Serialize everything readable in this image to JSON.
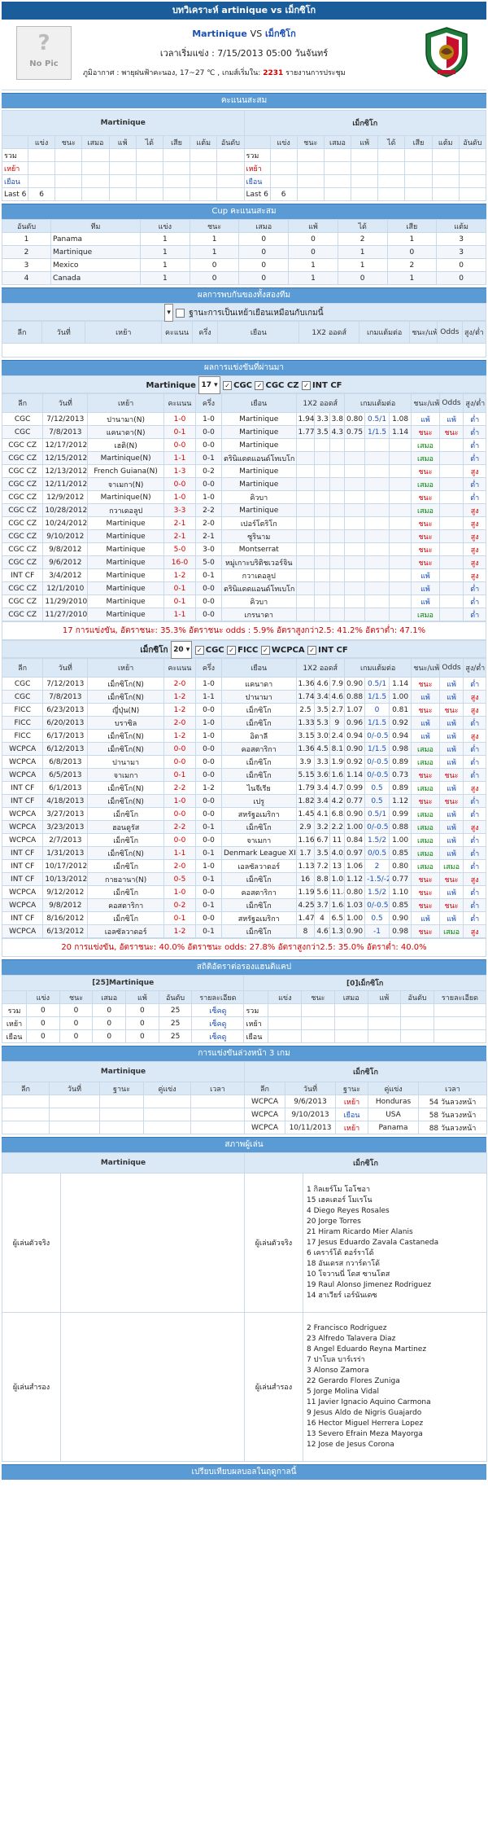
{
  "page_title": "บทวิเคราะห์ artinique vs เม็กซิโก",
  "match": {
    "nopic": "No Pic",
    "home": "Martinique",
    "vs": "VS",
    "away": "เม็กซิโก",
    "kickoff": "เวลาเริ่มแข่ง : 7/15/2013 05:00 วันจันทร์",
    "weather_label": "ภูมิอากาศ :",
    "weather": "พายุฝนฟ้าคะนอง, 17~27 ℃ , เกมส์เริ่มใน:",
    "countdown": "2231",
    "countdown_suffix": "รายงานการประชุม"
  },
  "standings": {
    "section": "คะแนนสะสม",
    "home_name": "Martinique",
    "away_name": "เม็กซิโก",
    "cols": [
      "แข่ง",
      "ชนะ",
      "เสมอ",
      "แพ้",
      "ได้",
      "เสีย",
      "แต้ม",
      "อันดับ"
    ],
    "rows": [
      "รวม",
      "เหย้า",
      "เยือน",
      "Last 6"
    ],
    "home_last6": "6",
    "away_last6": "6"
  },
  "cup": {
    "section": "Cup คะแนนสะสม",
    "headers": [
      "อันดับ",
      "ทีม",
      "แข่ง",
      "ชนะ",
      "เสมอ",
      "แพ้",
      "ได้",
      "เสีย",
      "แต้ม"
    ],
    "rows": [
      [
        "1",
        "Panama",
        "1",
        "1",
        "0",
        "0",
        "2",
        "1",
        "3"
      ],
      [
        "2",
        "Martinique",
        "1",
        "1",
        "0",
        "0",
        "1",
        "0",
        "3"
      ],
      [
        "3",
        "Mexico",
        "1",
        "0",
        "0",
        "1",
        "1",
        "2",
        "0"
      ],
      [
        "4",
        "Canada",
        "1",
        "0",
        "0",
        "1",
        "0",
        "1",
        "0"
      ]
    ]
  },
  "h2h": {
    "section": "ผลการพบกันของทั้งสองทีม",
    "same_venue": "ฐานะการเป็นเหย้าเยือนเหมือนกับเกมนี้",
    "headers": [
      "ลีก",
      "วันที่",
      "เหย้า",
      "คะแนน",
      "ครึ่ง",
      "เยือน",
      "1X2 ออดส์",
      "เกมแต้มต่อ",
      "ชนะ/แพ้",
      "Odds",
      "สูง/ต่ำ"
    ]
  },
  "recent": {
    "section": "ผลการแข่งขันที่ผ่านมา",
    "home_team": "Martinique",
    "home_select": "17",
    "home_filters": [
      "CGC",
      "CGC CZ",
      "INT CF"
    ],
    "headers": [
      "ลีก",
      "วันที่",
      "เหย้า",
      "คะแนน",
      "ครึ่ง",
      "เยือน",
      "1X2 ออดส์",
      "เกมแต้มต่อ",
      "ชนะ/แพ้",
      "Odds",
      "สูง/ต่ำ"
    ],
    "home_rows": [
      [
        "CGC",
        "7/12/2013",
        "ปานามา(N)",
        "1-0",
        "1-0",
        "Martinique",
        "1.94",
        "3.3",
        "3.8",
        "0.80",
        "0.5/1",
        "1.08",
        "แพ้",
        "แพ้",
        "ต่ำ"
      ],
      [
        "CGC",
        "7/8/2013",
        "แคนาดา(N)",
        "0-1",
        "0-0",
        "Martinique",
        "1.77",
        "3.5",
        "4.3",
        "0.75",
        "1/1.5",
        "1.14",
        "ชนะ",
        "ชนะ",
        "ต่ำ"
      ],
      [
        "CGC CZ",
        "12/17/2012",
        "เฮติ(N)",
        "0-0",
        "0-0",
        "Martinique",
        "",
        "",
        "",
        "",
        "",
        "",
        "เสมอ",
        "",
        "ต่ำ"
      ],
      [
        "CGC CZ",
        "12/15/2012",
        "Martinique(N)",
        "1-1",
        "0-1",
        "ตรินิแดดแอนด์โทเบโก",
        "",
        "",
        "",
        "",
        "",
        "",
        "เสมอ",
        "",
        "ต่ำ"
      ],
      [
        "CGC CZ",
        "12/13/2012",
        "French Guiana(N)",
        "1-3",
        "0-2",
        "Martinique",
        "",
        "",
        "",
        "",
        "",
        "",
        "ชนะ",
        "",
        "สูง"
      ],
      [
        "CGC CZ",
        "12/11/2012",
        "จาเมกา(N)",
        "0-0",
        "0-0",
        "Martinique",
        "",
        "",
        "",
        "",
        "",
        "",
        "เสมอ",
        "",
        "ต่ำ"
      ],
      [
        "CGC CZ",
        "12/9/2012",
        "Martinique(N)",
        "1-0",
        "1-0",
        "คิวบา",
        "",
        "",
        "",
        "",
        "",
        "",
        "ชนะ",
        "",
        "ต่ำ"
      ],
      [
        "CGC CZ",
        "10/28/2012",
        "กวาเดอลูป",
        "3-3",
        "2-2",
        "Martinique",
        "",
        "",
        "",
        "",
        "",
        "",
        "เสมอ",
        "",
        "สูง"
      ],
      [
        "CGC CZ",
        "10/24/2012",
        "Martinique",
        "2-1",
        "2-0",
        "เปอร์โตริโก",
        "",
        "",
        "",
        "",
        "",
        "",
        "ชนะ",
        "",
        "สูง"
      ],
      [
        "CGC CZ",
        "9/10/2012",
        "Martinique",
        "2-1",
        "2-1",
        "ซูรินาม",
        "",
        "",
        "",
        "",
        "",
        "",
        "ชนะ",
        "",
        "สูง"
      ],
      [
        "CGC CZ",
        "9/8/2012",
        "Martinique",
        "5-0",
        "3-0",
        "Montserrat",
        "",
        "",
        "",
        "",
        "",
        "",
        "ชนะ",
        "",
        "สูง"
      ],
      [
        "CGC CZ",
        "9/6/2012",
        "Martinique",
        "16-0",
        "5-0",
        "หมู่เกาะบริติชเวอร์จิน",
        "",
        "",
        "",
        "",
        "",
        "",
        "ชนะ",
        "",
        "สูง"
      ],
      [
        "INT CF",
        "3/4/2012",
        "Martinique",
        "1-2",
        "0-1",
        "กวาเดอลูป",
        "",
        "",
        "",
        "",
        "",
        "",
        "แพ้",
        "",
        "สูง"
      ],
      [
        "CGC CZ",
        "12/1/2010",
        "Martinique",
        "0-1",
        "0-0",
        "ตรินิแดดแอนด์โทเบโก",
        "",
        "",
        "",
        "",
        "",
        "",
        "แพ้",
        "",
        "ต่ำ"
      ],
      [
        "CGC CZ",
        "11/29/2010",
        "Martinique",
        "0-1",
        "0-0",
        "คิวบา",
        "",
        "",
        "",
        "",
        "",
        "",
        "แพ้",
        "",
        "ต่ำ"
      ],
      [
        "CGC CZ",
        "11/27/2010",
        "Martinique",
        "1-1",
        "0-0",
        "เกรนาดา",
        "",
        "",
        "",
        "",
        "",
        "",
        "เสมอ",
        "",
        "ต่ำ"
      ]
    ],
    "home_summary": "17 การแข่งขัน, อัตราชนะ: 35.3% อัตราชนะ odds : 5.9% อัตราสูงกว่า2.5: 41.2% อัตราต่ำ: 47.1%",
    "away_team": "เม็กซิโก",
    "away_select": "20",
    "away_filters": [
      "CGC",
      "FICC",
      "WCPCA",
      "INT CF"
    ],
    "away_rows": [
      [
        "CGC",
        "7/12/2013",
        "เม็กซิโก(N)",
        "2-0",
        "1-0",
        "แคนาดา",
        "1.36",
        "4.6",
        "7.9",
        "0.90",
        "0.5/1",
        "1.14",
        "ชนะ",
        "แพ้",
        "ต่ำ"
      ],
      [
        "CGC",
        "7/8/2013",
        "เม็กซิโก(N)",
        "1-2",
        "1-1",
        "ปานามา",
        "1.74",
        "3.45",
        "4.65",
        "0.88",
        "1/1.5",
        "1.00",
        "แพ้",
        "แพ้",
        "สูง"
      ],
      [
        "FICC",
        "6/23/2013",
        "ญี่ปุ่น(N)",
        "1-2",
        "0-0",
        "เม็กซิโก",
        "2.5",
        "3.5",
        "2.75",
        "1.07",
        "0",
        "0.81",
        "ชนะ",
        "ชนะ",
        "สูง"
      ],
      [
        "FICC",
        "6/20/2013",
        "บราซิล",
        "2-0",
        "1-0",
        "เม็กซิโก",
        "1.33",
        "5.3",
        "9",
        "0.96",
        "1/1.5",
        "0.92",
        "แพ้",
        "แพ้",
        "ต่ำ"
      ],
      [
        "FICC",
        "6/17/2013",
        "เม็กซิโก(N)",
        "1-2",
        "1-0",
        "อิตาลี",
        "3.15",
        "3.05",
        "2.47",
        "0.94",
        "0/-0.5",
        "0.94",
        "แพ้",
        "แพ้",
        "สูง"
      ],
      [
        "WCPCA",
        "6/12/2013",
        "เม็กซิโก(N)",
        "0-0",
        "0-0",
        "คอสตาริกา",
        "1.36",
        "4.5",
        "8.1",
        "0.90",
        "1/1.5",
        "0.98",
        "เสมอ",
        "แพ้",
        "ต่ำ"
      ],
      [
        "WCPCA",
        "6/8/2013",
        "ปานามา",
        "0-0",
        "0-0",
        "เม็กซิโก",
        "3.9",
        "3.3",
        "1.99",
        "0.92",
        "0/-0.5",
        "0.89",
        "เสมอ",
        "แพ้",
        "ต่ำ"
      ],
      [
        "WCPCA",
        "6/5/2013",
        "จาเมกา",
        "0-1",
        "0-0",
        "เม็กซิโก",
        "5.15",
        "3.65",
        "1.63",
        "1.14",
        "0/-0.5",
        "0.73",
        "ชนะ",
        "ชนะ",
        "ต่ำ"
      ],
      [
        "INT CF",
        "6/1/2013",
        "เม็กซิโก(N)",
        "2-2",
        "1-2",
        "ไนจีเรีย",
        "1.79",
        "3.4",
        "4.75",
        "0.99",
        "0.5",
        "0.89",
        "เสมอ",
        "แพ้",
        "สูง"
      ],
      [
        "INT CF",
        "4/18/2013",
        "เม็กซิโก(N)",
        "1-0",
        "0-0",
        "เปรู",
        "1.82",
        "3.4",
        "4.2",
        "0.77",
        "0.5",
        "1.12",
        "ชนะ",
        "ชนะ",
        "ต่ำ"
      ],
      [
        "WCPCA",
        "3/27/2013",
        "เม็กซิโก",
        "0-0",
        "0-0",
        "สหรัฐอเมริกา",
        "1.45",
        "4.1",
        "6.85",
        "0.90",
        "0.5/1",
        "0.99",
        "เสมอ",
        "แพ้",
        "ต่ำ"
      ],
      [
        "WCPCA",
        "3/23/2013",
        "ฮอนดูรัส",
        "2-2",
        "0-1",
        "เม็กซิโก",
        "2.9",
        "3.2",
        "2.25",
        "1.00",
        "0/-0.5",
        "0.88",
        "เสมอ",
        "แพ้",
        "สูง"
      ],
      [
        "WCPCA",
        "2/7/2013",
        "เม็กซิโก",
        "0-0",
        "0-0",
        "จาเมกา",
        "1.16",
        "6.7",
        "11",
        "0.84",
        "1.5/2",
        "1.00",
        "เสมอ",
        "แพ้",
        "ต่ำ"
      ],
      [
        "INT CF",
        "1/31/2013",
        "เม็กซิโก(N)",
        "1-1",
        "0-1",
        "Denmark League XI",
        "1.7",
        "3.5",
        "4.05",
        "0.97",
        "0/0.5",
        "0.85",
        "เสมอ",
        "แพ้",
        "ต่ำ"
      ],
      [
        "INT CF",
        "10/17/2012",
        "เม็กซิโก",
        "2-0",
        "1-0",
        "เอลซัลวาดอร์",
        "1.13",
        "7.2",
        "13",
        "1.06",
        "2",
        "0.80",
        "เสมอ",
        "เสมอ",
        "ต่ำ"
      ],
      [
        "INT CF",
        "10/13/2012",
        "กายอานา(N)",
        "0-5",
        "0-1",
        "เม็กซิโก",
        "16",
        "8.8",
        "1.08",
        "1.12",
        "-1.5/-2",
        "0.77",
        "ชนะ",
        "ชนะ",
        "สูง"
      ],
      [
        "WCPCA",
        "9/12/2012",
        "เม็กซิโก",
        "1-0",
        "0-0",
        "คอสตาริกา",
        "1.19",
        "5.6",
        "11.8",
        "0.80",
        "1.5/2",
        "1.10",
        "ชนะ",
        "แพ้",
        "ต่ำ"
      ],
      [
        "WCPCA",
        "9/8/2012",
        "คอสตาริกา",
        "0-2",
        "0-1",
        "เม็กซิโก",
        "4.25",
        "3.7",
        "1.68",
        "1.03",
        "0/-0.5",
        "0.85",
        "ชนะ",
        "ชนะ",
        "ต่ำ"
      ],
      [
        "INT CF",
        "8/16/2012",
        "เม็กซิโก",
        "0-1",
        "0-0",
        "สหรัฐอเมริกา",
        "1.47",
        "4",
        "6.55",
        "1.00",
        "0.5",
        "0.90",
        "แพ้",
        "แพ้",
        "ต่ำ"
      ],
      [
        "WCPCA",
        "6/13/2012",
        "เอลซัลวาดอร์",
        "1-2",
        "0-1",
        "เม็กซิโก",
        "8",
        "4.67",
        "1.35",
        "0.90",
        "-1",
        "0.98",
        "ชนะ",
        "เสมอ",
        "สูง"
      ]
    ],
    "away_summary": "20 การแข่งขัน, อัตราชนะ: 40.0% อัตราชนะ odds: 27.8% อัตราสูงกว่า2.5: 35.0% อัตราต่ำ: 40.0%"
  },
  "hcap": {
    "section": "สถิติอัตราต่อรองแฮนดิแคป",
    "home_name": "[25]Martinique",
    "away_name": "[0]เม็กซิโก",
    "cols": [
      "แข่ง",
      "ชนะ",
      "เสมอ",
      "แพ้",
      "อันดับ",
      "รายละเอียด"
    ],
    "home_rows": [
      [
        "รวม",
        "0",
        "0",
        "0",
        "0",
        "25",
        "เซ็คดู"
      ],
      [
        "เหย้า",
        "0",
        "0",
        "0",
        "0",
        "25",
        "เซ็คดู"
      ],
      [
        "เยือน",
        "0",
        "0",
        "0",
        "0",
        "25",
        "เซ็คดู"
      ]
    ],
    "away_rows": [
      "รวม",
      "เหย้า",
      "เยือน"
    ]
  },
  "next": {
    "section": "การแข่งขันล่วงหน้า 3 เกม",
    "home_name": "Martinique",
    "away_name": "เม็กซิโก",
    "cols": [
      "ลีก",
      "วันที่",
      "ฐานะ",
      "คู่แข่ง",
      "เวลา"
    ],
    "away_rows": [
      [
        "WCPCA",
        "9/6/2013",
        "เหย้า",
        "Honduras",
        "54 วันลวงหน้า"
      ],
      [
        "WCPCA",
        "9/10/2013",
        "เยือน",
        "USA",
        "58 วันลวงหน้า"
      ],
      [
        "WCPCA",
        "10/11/2013",
        "เหย้า",
        "Panama",
        "88 วันลวงหน้า"
      ]
    ]
  },
  "lineup": {
    "section": "สภาพผู้เล่น",
    "home_name": "Martinique",
    "away_name": "เม็กซิโก",
    "starters_label": "ผู้เล่นตัวจริง",
    "subs_label": "ผู้เล่นสำรอง",
    "away_starters": [
      "1  กิลเยร์โม โอโชอา",
      "15 เฮคเตอร์ โมเรโน",
      "4  Diego Reyes Rosales",
      "20 Jorge Torres",
      "21 Hiram Ricardo Mier Alanis",
      "17 Jesus Eduardo Zavala Castaneda",
      "6  เคราร์โด้ ตอร์ราโด้",
      "18 อันเดรส กวาร์ดาโด้",
      "10 โจวานนี่ โดส ซานโตส",
      "19 Raul Alonso Jimenez Rodriguez",
      "14 ฮาเวียร์ เอร์นันเดซ"
    ],
    "away_subs": [
      "2  Francisco Rodriguez",
      "23 Alfredo Talavera Diaz",
      "8  Angel Eduardo Reyna Martinez",
      "7  ปาโบล บาร์เรร่า",
      "3  Alonso Zamora",
      "22 Gerardo Flores Zuniga",
      "5  Jorge Molina Vidal",
      "11 Javier Ignacio Aquino Carmona",
      "9  Jesus Aldo de Nigris Guajardo",
      "16 Hector Miguel Herrera Lopez",
      "13 Severo Efrain Meza Mayorga",
      "12 Jose de Jesus Corona"
    ]
  },
  "footer": {
    "section": "เปรียบเทียบผลบอลในฤดูกาลนี้"
  }
}
